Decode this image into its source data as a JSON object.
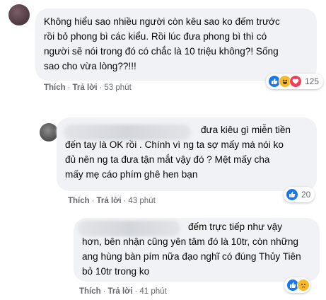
{
  "comments": [
    {
      "text": "Không hiểu sao nhiều người còn kêu sao ko đếm trước\nrồi bỏ phong bì các kiểu. Rồi lúc đưa phong bì thì có\nngười sẽ nói trong đó có chắc là 10 triệu không?! Sống\nsao cho vừa lòng??!!!",
      "like_label": "Thích",
      "reply_label": "Trả lời",
      "time": "53 phút",
      "reaction_count": "125",
      "reactions": [
        "like-icon",
        "haha-icon",
        "love-icon"
      ]
    },
    {
      "text_first_line": "đưa kiêu gì miễn tiền",
      "text": "đến tay là OK rồi . Chính vì ng ta sợ mấy má nói ko\nđủ nên ng ta đưa tận mắt vậy đó ? Mệt mấy cha\nmấy mẹ cáo phím ghê hen bạn",
      "like_label": "Thích",
      "reply_label": "Trả lời",
      "time": "43 phút",
      "reaction_count": "20",
      "reactions": [
        "like-icon",
        "haha-icon"
      ]
    },
    {
      "text_first_line": "đếm trực tiếp như vậy",
      "text": "hơn, bên nhận cũng yên tâm đó là 10tr, còn những\nang hùng bàn pím nữa đạo nghĩ có đúng Thủy Tiên\nbỏ 10tr trong ko",
      "like_label": "Thích",
      "reply_label": "Trả lời",
      "time": "41 phút",
      "reactions": [
        "like-icon",
        "sad-icon"
      ]
    }
  ],
  "colors": {
    "bubble": "#f0f2f5",
    "meta": "#65676b",
    "like": "#1877f2",
    "love": "#f33e58",
    "haha": "#f7b928"
  }
}
